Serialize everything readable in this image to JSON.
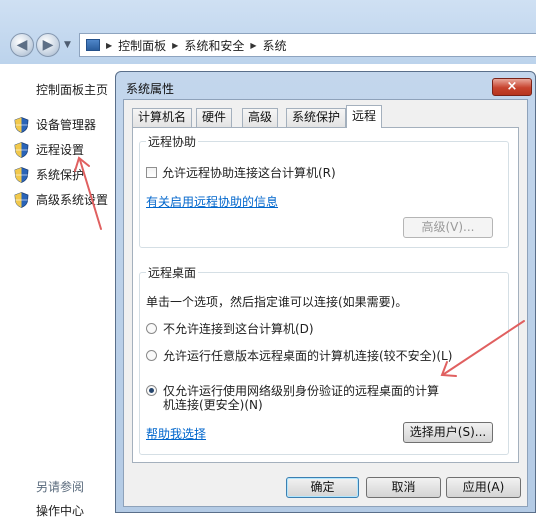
{
  "explorer": {
    "breadcrumb": [
      "控制面板",
      "系统和安全",
      "系统"
    ],
    "sidebar_home": "控制面板主页",
    "sidebar_links": [
      "设备管理器",
      "远程设置",
      "系统保护",
      "高级系统设置"
    ],
    "see_also": "另请参阅",
    "action_center": "操作中心"
  },
  "dialog": {
    "title": "系统属性",
    "close_glyph": "×",
    "tabs": [
      "计算机名",
      "硬件",
      "高级",
      "系统保护",
      "远程"
    ],
    "active_tab": "远程",
    "remote_assistance": {
      "title": "远程协助",
      "checkbox_label": "允许远程协助连接这台计算机(R)",
      "checkbox_checked": false,
      "info_link": "有关启用远程协助的信息",
      "advanced_button": "高级(V)..."
    },
    "remote_desktop": {
      "title": "远程桌面",
      "instruction": "单击一个选项，然后指定谁可以连接(如果需要)。",
      "options": [
        "不允许连接到这台计算机(D)",
        "允许运行任意版本远程桌面的计算机连接(较不安全)(L)",
        "仅允许运行使用网络级别身份验证的远程桌面的计算机连接(更安全)(N)"
      ],
      "option3_line1": "仅允许运行使用网络级别身份验证的远程桌面的计算",
      "option3_line2": "机连接(更安全)(N)",
      "selected_option_index": 2,
      "help_link": "帮助我选择",
      "select_users_button": "选择用户(S)..."
    },
    "buttons": {
      "ok": "确定",
      "cancel": "取消",
      "apply": "应用(A)"
    }
  },
  "colors": {
    "link": "#0066cc",
    "annotation_arrow": "#e06060",
    "dialog_frame": "#b4cbe5"
  }
}
